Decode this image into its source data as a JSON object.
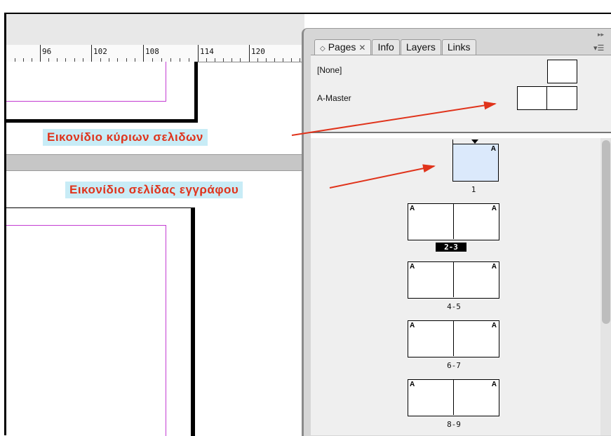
{
  "ruler": {
    "ticks": [
      "96",
      "102",
      "108",
      "114",
      "120"
    ]
  },
  "panel": {
    "tabs": [
      {
        "label": "Pages",
        "active": true
      },
      {
        "label": "Info",
        "active": false
      },
      {
        "label": "Layers",
        "active": false
      },
      {
        "label": "Links",
        "active": false
      }
    ],
    "masters": [
      {
        "label": "[None]"
      },
      {
        "label": "A-Master"
      }
    ],
    "pages": [
      {
        "label": "1",
        "master": "A",
        "selected": true
      },
      {
        "label": "2-3",
        "master": "A",
        "selected": false,
        "highlighted": true
      },
      {
        "label": "4-5",
        "master": "A",
        "selected": false
      },
      {
        "label": "6-7",
        "master": "A",
        "selected": false
      },
      {
        "label": "8-9",
        "master": "A",
        "selected": false
      }
    ]
  },
  "callouts": {
    "master_icon": "Εικονίδιο κύριων σελιδων",
    "document_page_icon": "Εικονίδιο σελίδας εγγράφου"
  },
  "colors": {
    "callout_text": "#e0331b",
    "callout_bg": "#c8ecf6",
    "margin_guide": "#c33cd2",
    "selected_page": "#dbe9fb"
  }
}
